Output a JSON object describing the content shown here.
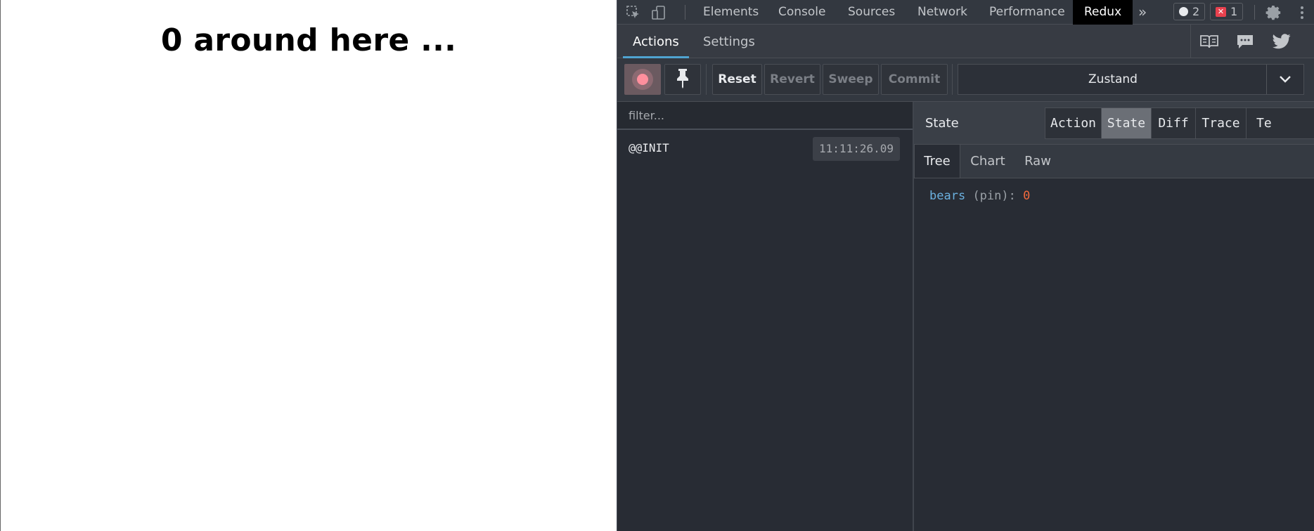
{
  "page": {
    "heading": "0 around here ..."
  },
  "devtools": {
    "tabs": [
      "Elements",
      "Console",
      "Sources",
      "Network",
      "Performance",
      "Redux"
    ],
    "active_tab": "Redux",
    "more_label": "»",
    "warnings_count": "2",
    "errors_count": "1",
    "icons": [
      "inspect-element-icon",
      "device-toolbar-icon",
      "more-tabs-icon",
      "settings-gear-icon",
      "kebab-menu-icon"
    ]
  },
  "redux": {
    "header_tabs": [
      "Actions",
      "Settings"
    ],
    "active_header_tab": "Actions",
    "header_icons": [
      "docs-book-icon",
      "chat-bubble-icon",
      "twitter-icon"
    ],
    "toolbar": {
      "reset": "Reset",
      "revert": "Revert",
      "sweep": "Sweep",
      "commit": "Commit",
      "instance": "Zustand"
    },
    "filter_placeholder": "filter...",
    "actions": [
      {
        "name": "@@INIT",
        "time": "11:11:26.09"
      }
    ],
    "inspector": {
      "title": "State",
      "tabs": [
        "Action",
        "State",
        "Diff",
        "Trace",
        "Te"
      ],
      "active_tab": "State",
      "subtabs": [
        "Tree",
        "Chart",
        "Raw"
      ],
      "active_subtab": "Tree",
      "tree": [
        {
          "key": "bears",
          "tag": "(pin):",
          "value": "0"
        }
      ]
    }
  },
  "colors": {
    "accent_underline": "#4fa3d1",
    "record_red": "#ff8f9d",
    "number_value": "#f0693d",
    "key_blue": "#6bb1e0"
  }
}
